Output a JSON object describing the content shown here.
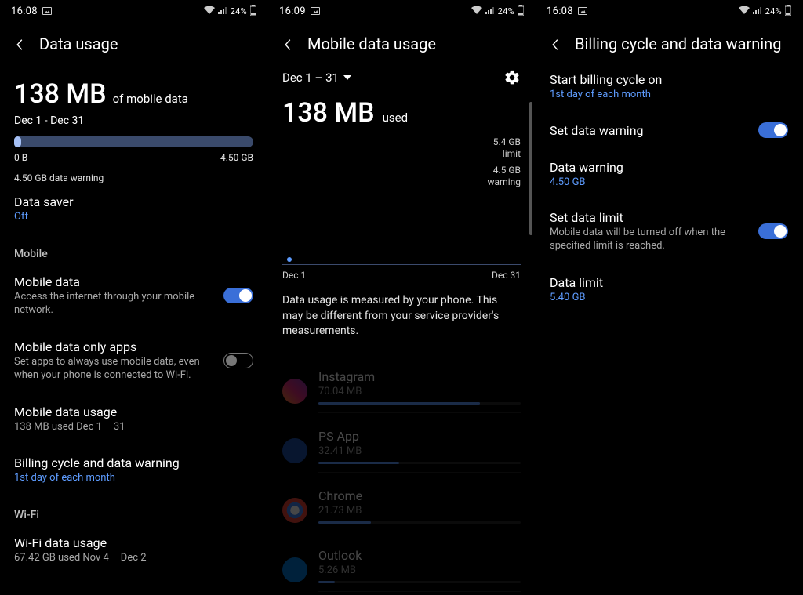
{
  "screen1": {
    "status_time": "16:08",
    "status_batt": "24%",
    "title": "Data usage",
    "usage_num": "138 MB",
    "usage_suffix": "of mobile data",
    "date_range": "Dec 1 - Dec 31",
    "bar_min": "0 B",
    "bar_max": "4.50 GB",
    "bar_fill_pct": 3,
    "warning_note": "4.50 GB data warning",
    "data_saver_label": "Data saver",
    "data_saver_value": "Off",
    "section_mobile": "Mobile",
    "mobile_data_label": "Mobile data",
    "mobile_data_sub": "Access the internet through your mobile network.",
    "mobile_data_only_label": "Mobile data only apps",
    "mobile_data_only_sub": "Set apps to always use mobile data, even when your phone is connected to Wi-Fi.",
    "mobile_usage_label": "Mobile data usage",
    "mobile_usage_sub": "138 MB used Dec 1 – 31",
    "billing_label": "Billing cycle and data warning",
    "billing_sub": "1st day of each month",
    "section_wifi": "Wi-Fi",
    "wifi_usage_label": "Wi-Fi data usage",
    "wifi_usage_sub": "67.42 GB used Nov 4 – Dec 2"
  },
  "screen2": {
    "status_time": "16:09",
    "status_batt": "24%",
    "title": "Mobile data usage",
    "period": "Dec 1 – 31",
    "usage_num": "138 MB",
    "usage_suffix": "used",
    "limit_val": "5.4 GB",
    "limit_lab": "limit",
    "warn_val": "4.5 GB",
    "warn_lab": "warning",
    "chart_start": "Dec 1",
    "chart_end": "Dec 31",
    "note": "Data usage is measured by your phone. This may be different from your service provider's measurements.",
    "apps": [
      {
        "name": "Instagram",
        "amount": "70.04 MB",
        "pct": 80,
        "color": "linear-gradient(45deg,#f58529,#dd2a7b,#8134af)"
      },
      {
        "name": "PS App",
        "amount": "32.41 MB",
        "pct": 40,
        "color": "#1e4fa8"
      },
      {
        "name": "Chrome",
        "amount": "21.73 MB",
        "pct": 26,
        "color": "radial-gradient(circle,#fff 25%,#4285f4 26% 45%,#ea4335 46% 100%)"
      },
      {
        "name": "Outlook",
        "amount": "5.26 MB",
        "pct": 8,
        "color": "#0078d4"
      }
    ]
  },
  "screen3": {
    "status_time": "16:08",
    "status_batt": "24%",
    "title": "Billing cycle and data warning",
    "start_label": "Start billing cycle on",
    "start_value": "1st day of each month",
    "set_warn_label": "Set data warning",
    "data_warn_label": "Data warning",
    "data_warn_value": "4.50 GB",
    "set_limit_label": "Set data limit",
    "set_limit_sub": "Mobile data will be turned off when the specified limit is reached.",
    "data_limit_label": "Data limit",
    "data_limit_value": "5.40 GB"
  },
  "chart_data": {
    "type": "bar",
    "title": "Mobile data usage Dec 1 – 31",
    "categories": [
      "Dec 1",
      "Dec 31"
    ],
    "values": [
      138
    ],
    "xlabel": "",
    "ylabel": "MB",
    "limit_gb": 5.4,
    "warning_gb": 4.5,
    "ylim": [
      0,
      5530
    ]
  }
}
